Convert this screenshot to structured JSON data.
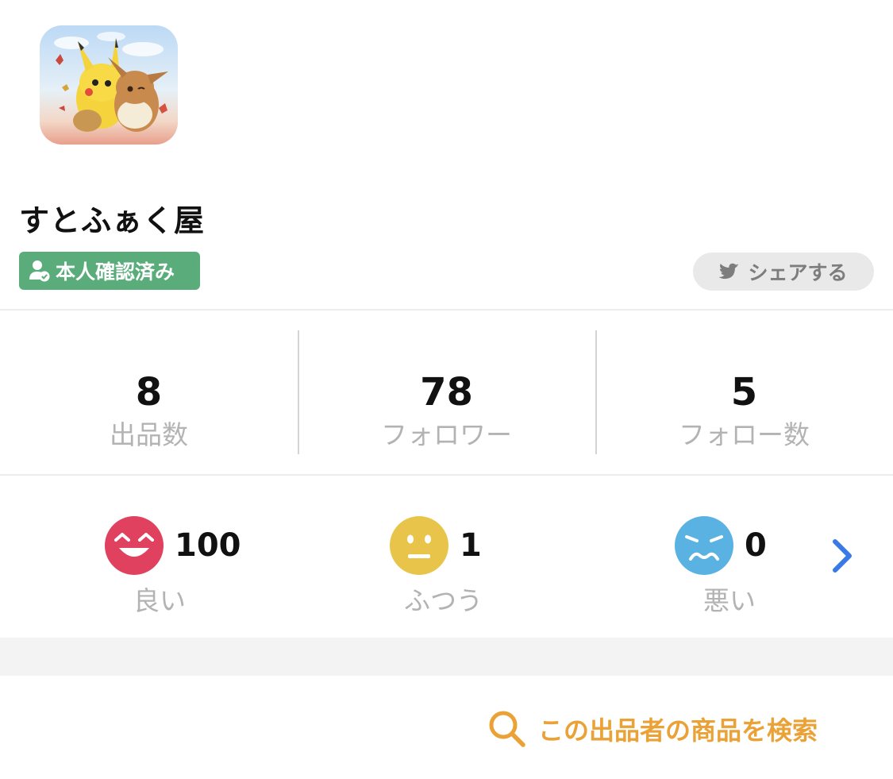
{
  "profile": {
    "shop_name": "すとふぁく屋",
    "verified_label": "本人確認済み",
    "share_label": "シェアする"
  },
  "stats": [
    {
      "value": "8",
      "label": "出品数"
    },
    {
      "value": "78",
      "label": "フォロワー"
    },
    {
      "value": "5",
      "label": "フォロー数"
    }
  ],
  "ratings": {
    "good": {
      "value": "100",
      "label": "良い",
      "color": "#e0415e"
    },
    "normal": {
      "value": "1",
      "label": "ふつう",
      "color": "#e8c44b"
    },
    "bad": {
      "value": "0",
      "label": "悪い",
      "color": "#5ab2e2"
    }
  },
  "search": {
    "label": "この出品者の商品を検索",
    "color": "#eaa237"
  },
  "icons": {
    "verified": "person-check-icon",
    "share": "twitter-bird-icon",
    "more": "chevron-right-icon",
    "search": "search-icon"
  }
}
